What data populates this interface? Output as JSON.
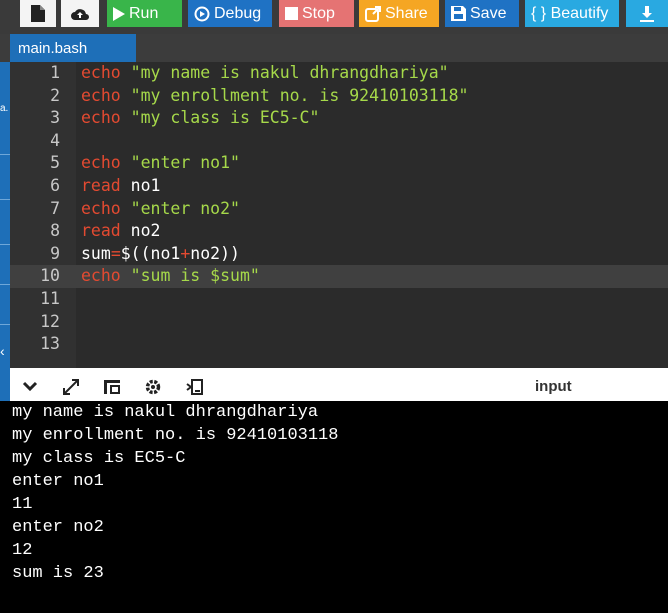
{
  "toolbar": {
    "run_label": "Run",
    "debug_label": "Debug",
    "stop_label": "Stop",
    "share_label": "Share",
    "save_label": "Save",
    "beautify_label": "{ } Beautify",
    "colors": {
      "run": "#39b54a",
      "debug": "#1f72c4",
      "stop": "#e57373",
      "share": "#f5a623",
      "save": "#1f72c4",
      "beautify": "#29a9e1",
      "download": "#29a9e1"
    }
  },
  "tab": {
    "label": "main.bash"
  },
  "editor": {
    "lines": [
      {
        "num": "1",
        "kw": "echo",
        "rest": " \"my name is nakul dhrangdhariya\""
      },
      {
        "num": "2",
        "kw": "echo",
        "rest": " \"my enrollment no. is 92410103118\""
      },
      {
        "num": "3",
        "kw": "echo",
        "rest": " \"my class is EC5-C\""
      },
      {
        "num": "4"
      },
      {
        "num": "5",
        "kw": "echo",
        "rest": " \"enter no1\""
      },
      {
        "num": "6",
        "kw": "read",
        "rest": " no1"
      },
      {
        "num": "7",
        "kw": "echo",
        "rest": " \"enter no2\""
      },
      {
        "num": "8",
        "kw": "read",
        "rest": " no2"
      },
      {
        "num": "9",
        "a": "sum",
        "op1": "=",
        "b": "$((no1",
        "op2": "+",
        "c": "no2))"
      },
      {
        "num": "10",
        "kw": "echo",
        "rest": " \"sum is $sum\""
      },
      {
        "num": "11"
      },
      {
        "num": "12"
      },
      {
        "num": "13"
      }
    ]
  },
  "output_bar": {
    "input_label": "input"
  },
  "console": {
    "lines": [
      "my name is nakul dhrangdhariya",
      "my enrollment no. is 92410103118",
      "my class is EC5-C",
      "enter no1",
      "11",
      "enter no2",
      "12",
      "sum is 23"
    ]
  },
  "icons": [
    "new-file-icon",
    "upload-icon",
    "play-icon",
    "debug-icon",
    "stop-icon",
    "share-icon",
    "save-icon",
    "download-icon",
    "collapse-icon",
    "expand-icon",
    "layout-icon",
    "gear-icon",
    "command-icon"
  ]
}
